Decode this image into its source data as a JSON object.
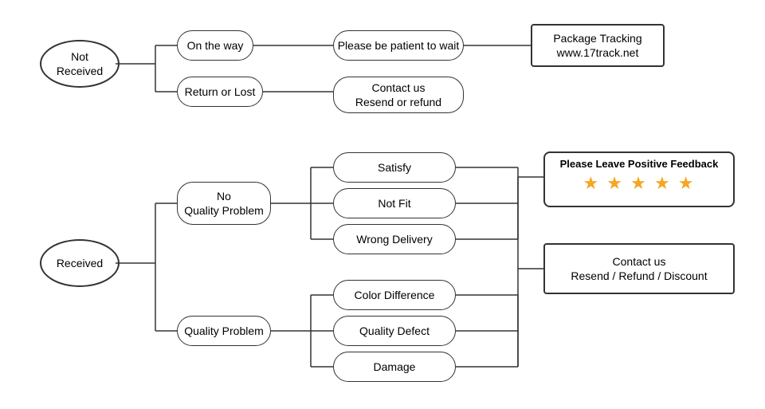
{
  "nodes": {
    "not_received": {
      "label": "Not\nReceived"
    },
    "on_the_way": {
      "label": "On the way"
    },
    "return_or_lost": {
      "label": "Return or Lost"
    },
    "patient_wait": {
      "label": "Please be patient to wait"
    },
    "package_tracking": {
      "label": "Package Tracking\nwww.17track.net"
    },
    "contact_resend_refund": {
      "label": "Contact us\nResend or refund"
    },
    "received": {
      "label": "Received"
    },
    "no_quality_problem": {
      "label": "No\nQuality Problem"
    },
    "quality_problem": {
      "label": "Quality Problem"
    },
    "satisfy": {
      "label": "Satisfy"
    },
    "not_fit": {
      "label": "Not Fit"
    },
    "wrong_delivery": {
      "label": "Wrong Delivery"
    },
    "color_difference": {
      "label": "Color Difference"
    },
    "quality_defect": {
      "label": "Quality Defect"
    },
    "damage": {
      "label": "Damage"
    },
    "feedback_title": {
      "label": "Please Leave Positive Feedback"
    },
    "stars": {
      "label": "★ ★ ★ ★ ★"
    },
    "contact_resend_refund_discount": {
      "label": "Contact us\nResend / Refund / Discount"
    }
  }
}
